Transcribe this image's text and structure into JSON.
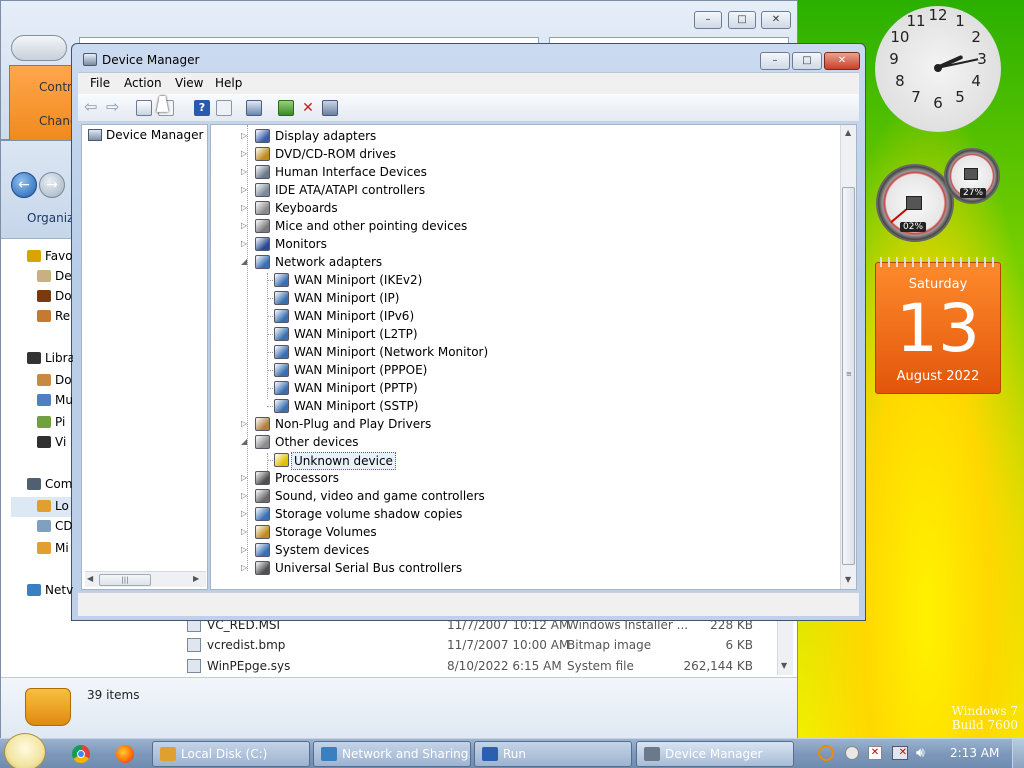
{
  "watermark": {
    "line1": "Windows 7",
    "line2": "Build 7600"
  },
  "control_panel": {
    "tile1": "Contro",
    "tile2": "Chang"
  },
  "explorer": {
    "organize": "Organize",
    "nav": [
      {
        "label": "Favo",
        "color": "#d9a400"
      },
      {
        "label": "De",
        "color": "#c8b080"
      },
      {
        "label": "Do",
        "color": "#7a3a10"
      },
      {
        "label": "Re",
        "color": "#c47a30"
      },
      {
        "label": "Libra",
        "color": "#333333"
      },
      {
        "label": "Do",
        "color": "#c88a40"
      },
      {
        "label": "Mu",
        "color": "#5080c0"
      },
      {
        "label": "Pi",
        "color": "#70a040"
      },
      {
        "label": "Vi",
        "color": "#303030"
      },
      {
        "label": "Com",
        "color": "#506070"
      },
      {
        "label": "Lo",
        "color": "#e0a030"
      },
      {
        "label": "CD",
        "color": "#80a0c0"
      },
      {
        "label": "Mi",
        "color": "#e0a030"
      },
      {
        "label": "Netv",
        "color": "#3a80c0"
      }
    ],
    "files": [
      {
        "name": "VC_RED.MSI",
        "date": "11/7/2007 10:12 AM",
        "type": "Windows Installer ...",
        "size": "228 KB"
      },
      {
        "name": "vcredist.bmp",
        "date": "11/7/2007 10:00 AM",
        "type": "Bitmap image",
        "size": "6 KB"
      },
      {
        "name": "WinPEpge.sys",
        "date": "8/10/2022 6:15 AM",
        "type": "System file",
        "size": "262,144 KB"
      }
    ],
    "item_count": "39 items"
  },
  "device_manager": {
    "title": "Device Manager",
    "menus": [
      "File",
      "Action",
      "View",
      "Help"
    ],
    "left_pane_item": "Device Manager or",
    "tree": [
      {
        "label": "Display adapters",
        "level": 0,
        "state": "collapsed",
        "color": "#3a5fa8"
      },
      {
        "label": "DVD/CD-ROM drives",
        "level": 0,
        "state": "collapsed",
        "color": "#c08a20"
      },
      {
        "label": "Human Interface Devices",
        "level": 0,
        "state": "collapsed",
        "color": "#6a7a8a"
      },
      {
        "label": "IDE ATA/ATAPI controllers",
        "level": 0,
        "state": "collapsed",
        "color": "#7a8a9a"
      },
      {
        "label": "Keyboards",
        "level": 0,
        "state": "collapsed",
        "color": "#8a8a8a"
      },
      {
        "label": "Mice and other pointing devices",
        "level": 0,
        "state": "collapsed",
        "color": "#7a7a7a"
      },
      {
        "label": "Monitors",
        "level": 0,
        "state": "collapsed",
        "color": "#2a4a90"
      },
      {
        "label": "Network adapters",
        "level": 0,
        "state": "expanded",
        "color": "#3a70b0"
      },
      {
        "label": "WAN Miniport (IKEv2)",
        "level": 1,
        "state": "leaf",
        "color": "#3a70b0"
      },
      {
        "label": "WAN Miniport (IP)",
        "level": 1,
        "state": "leaf",
        "color": "#3a70b0"
      },
      {
        "label": "WAN Miniport (IPv6)",
        "level": 1,
        "state": "leaf",
        "color": "#3a70b0"
      },
      {
        "label": "WAN Miniport (L2TP)",
        "level": 1,
        "state": "leaf",
        "color": "#3a70b0"
      },
      {
        "label": "WAN Miniport (Network Monitor)",
        "level": 1,
        "state": "leaf",
        "color": "#3a70b0"
      },
      {
        "label": "WAN Miniport (PPPOE)",
        "level": 1,
        "state": "leaf",
        "color": "#3a70b0"
      },
      {
        "label": "WAN Miniport (PPTP)",
        "level": 1,
        "state": "leaf",
        "color": "#3a70b0"
      },
      {
        "label": "WAN Miniport (SSTP)",
        "level": 1,
        "state": "leaf",
        "color": "#3a70b0"
      },
      {
        "label": "Non-Plug and Play Drivers",
        "level": 0,
        "state": "collapsed",
        "color": "#b08040"
      },
      {
        "label": "Other devices",
        "level": 0,
        "state": "expanded",
        "color": "#8a8a8a"
      },
      {
        "label": "Unknown device",
        "level": 1,
        "state": "selected",
        "color": "#e0c000"
      },
      {
        "label": "Processors",
        "level": 0,
        "state": "collapsed",
        "color": "#505050"
      },
      {
        "label": "Sound, video and game controllers",
        "level": 0,
        "state": "collapsed",
        "color": "#6a6a6a"
      },
      {
        "label": "Storage volume shadow copies",
        "level": 0,
        "state": "collapsed",
        "color": "#3a70b0"
      },
      {
        "label": "Storage Volumes",
        "level": 0,
        "state": "collapsed",
        "color": "#c08a20"
      },
      {
        "label": "System devices",
        "level": 0,
        "state": "collapsed",
        "color": "#3a70b0"
      },
      {
        "label": "Universal Serial Bus controllers",
        "level": 0,
        "state": "collapsed",
        "color": "#505050"
      }
    ]
  },
  "gadgets": {
    "clock_numbers": [
      "12",
      "1",
      "2",
      "3",
      "4",
      "5",
      "6",
      "7",
      "8",
      "9",
      "10",
      "11"
    ],
    "cpu_percent": "02%",
    "memory_percent": "27%",
    "calendar": {
      "weekday": "Saturday",
      "day": "13",
      "month_year": "August 2022"
    }
  },
  "taskbar": {
    "tasks": [
      {
        "label": "Local Disk (C:)",
        "color": "#e0a030"
      },
      {
        "label": "Network and Sharing...",
        "color": "#3a80c0"
      },
      {
        "label": "Run",
        "color": "#2a60b0"
      },
      {
        "label": "Device Manager",
        "color": "#6a7a8a"
      }
    ],
    "time": "2:13 AM"
  }
}
